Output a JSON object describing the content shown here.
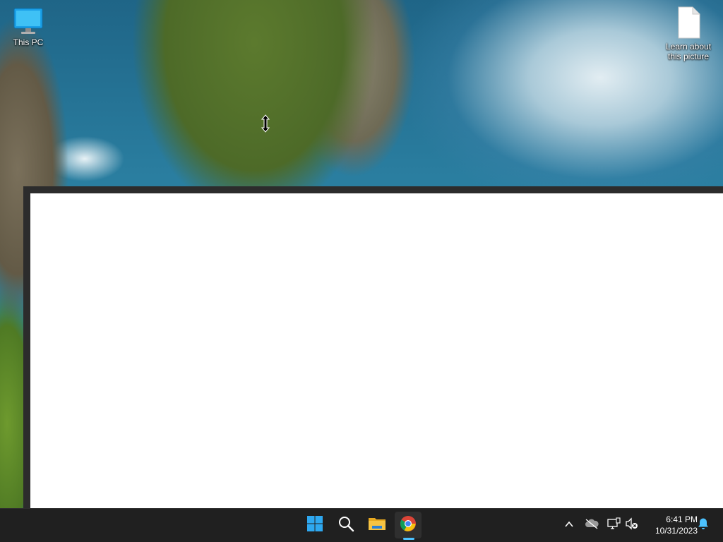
{
  "desktop": {
    "icons": [
      {
        "label": "This PC",
        "icon": "monitor-icon"
      },
      {
        "label": "Learn about this picture",
        "icon": "document-icon"
      }
    ]
  },
  "cursor": {
    "icon": "resize-vertical-cursor"
  },
  "window": {
    "frame_color": "#2c2c2c",
    "content_color": "#ffffff"
  },
  "taskbar": {
    "background": "#202020",
    "pinned": [
      {
        "name": "start",
        "icon": "windows-logo-icon"
      },
      {
        "name": "search",
        "icon": "search-icon"
      },
      {
        "name": "file-explorer",
        "icon": "folder-icon"
      },
      {
        "name": "chrome",
        "icon": "chrome-icon",
        "active": true
      }
    ],
    "accent": "#4cc2ff",
    "tray": [
      {
        "name": "show-hidden-icons",
        "icon": "chevron-up-icon"
      },
      {
        "name": "onedrive",
        "icon": "cloud-offline-icon"
      },
      {
        "name": "network",
        "icon": "network-icon"
      },
      {
        "name": "volume",
        "icon": "volume-muted-icon"
      }
    ],
    "clock": {
      "time": "6:41 PM",
      "date": "10/31/2023"
    },
    "notifications": {
      "icon": "bell-icon"
    }
  }
}
